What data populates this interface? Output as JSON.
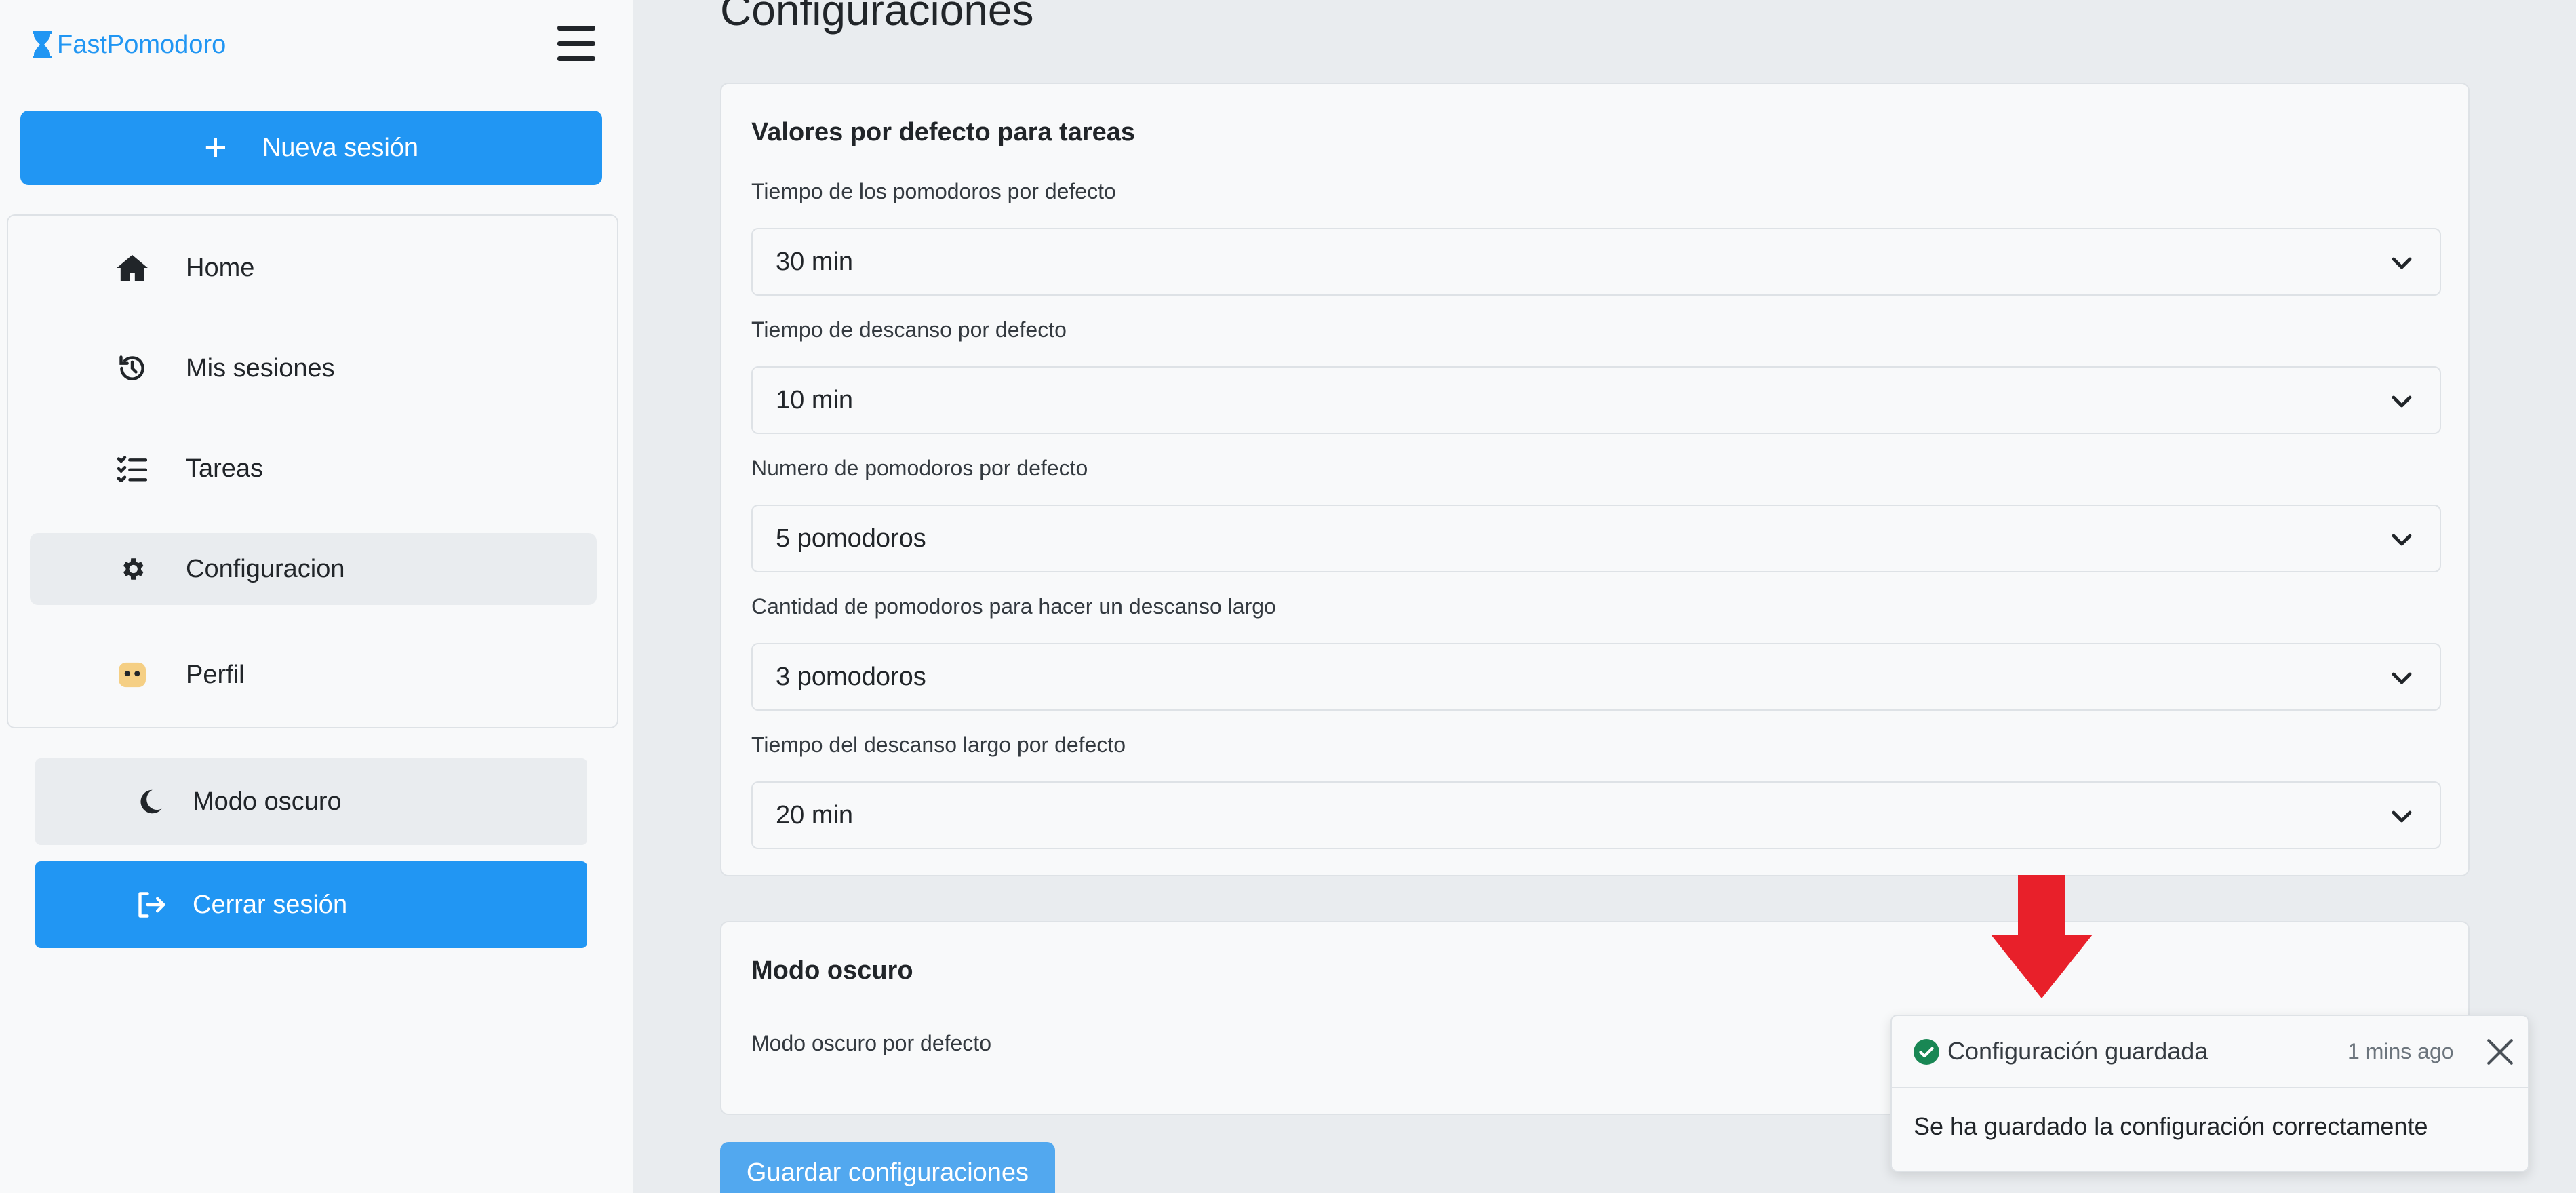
{
  "sidebar": {
    "brand": "FastPomodoro",
    "new_session": "Nueva sesión",
    "items": [
      {
        "label": "Home",
        "icon": "home-icon"
      },
      {
        "label": "Mis sesiones",
        "icon": "history-icon"
      },
      {
        "label": "Tareas",
        "icon": "checklist-icon"
      },
      {
        "label": "Configuracion",
        "icon": "gear-icon",
        "active": true
      },
      {
        "label": "Perfil",
        "icon": "avatar-icon"
      }
    ],
    "dark_mode": "Modo oscuro",
    "logout": "Cerrar sesión"
  },
  "main": {
    "title": "Configuraciones",
    "defaults_card": {
      "title": "Valores por defecto para tareas",
      "fields": [
        {
          "label": "Tiempo de los pomodoros por defecto",
          "value": "30 min"
        },
        {
          "label": "Tiempo de descanso por defecto",
          "value": "10 min"
        },
        {
          "label": "Numero de pomodoros por defecto",
          "value": "5 pomodoros"
        },
        {
          "label": "Cantidad de pomodoros para hacer un descanso largo",
          "value": "3 pomodoros"
        },
        {
          "label": "Tiempo del descanso largo por defecto",
          "value": "20 min"
        }
      ]
    },
    "dark_card": {
      "title": "Modo oscuro",
      "label": "Modo oscuro por defecto"
    },
    "save_button": "Guardar configuraciones"
  },
  "toast": {
    "title": "Configuración guardada",
    "time": "1 mins ago",
    "body": "Se ha guardado la configuración correctamente"
  },
  "colors": {
    "primary": "#2196f3",
    "success": "#198754",
    "annotation_arrow": "#e8202a"
  }
}
